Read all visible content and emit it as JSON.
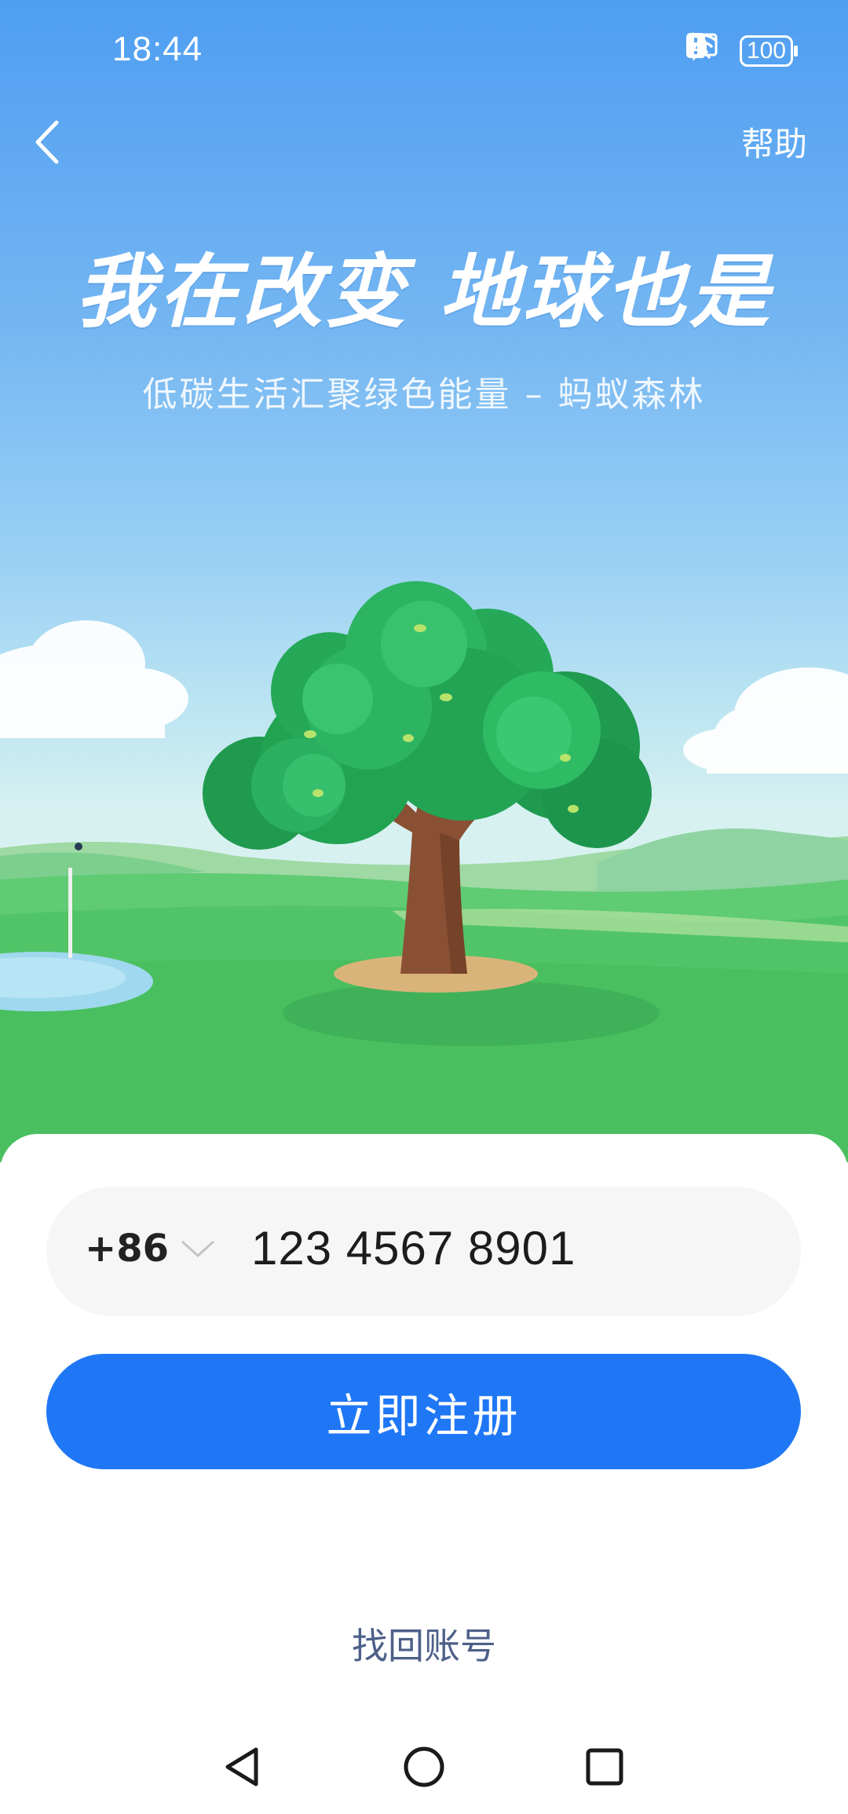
{
  "status_bar": {
    "time": "18:44",
    "battery": "100",
    "icons": [
      "cast-icon",
      "bluetooth-icon",
      "mute-bell-icon",
      "wifi-icon",
      "alert-badge-icon",
      "battery-icon",
      "charging-bolt-icon"
    ]
  },
  "header": {
    "back_icon": "chevron-left-icon",
    "help_label": "帮助"
  },
  "hero": {
    "headline": "我在改变 地球也是",
    "subline": "低碳生活汇聚绿色能量 – 蚂蚁森林"
  },
  "form": {
    "country_code": "+86",
    "phone_value": "123 4567 8901",
    "register_label": "立即注册",
    "recover_label": "找回账号"
  },
  "nav": {
    "icons": [
      "back-triangle-icon",
      "home-circle-icon",
      "recents-square-icon"
    ]
  },
  "colors": {
    "primary": "#1f77f6",
    "sky_top": "#4f9ef2",
    "grass": "#4cc46a",
    "link": "#4d6088"
  }
}
